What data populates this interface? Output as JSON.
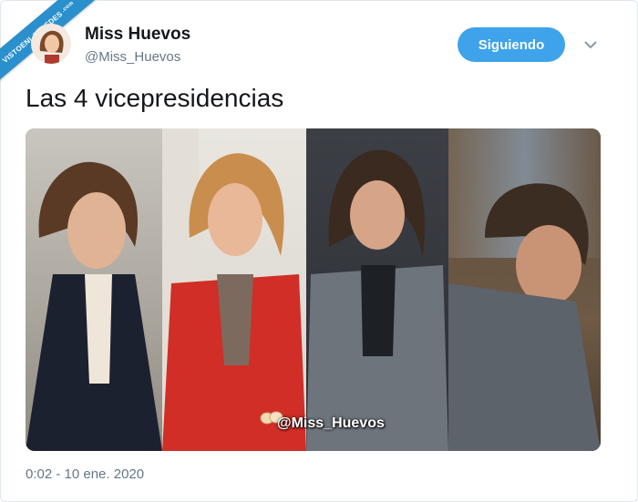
{
  "watermark_site": "VISTOENLASREDES",
  "watermark_site_suffix": ".com",
  "author": {
    "name": "Miss Huevos",
    "handle": "@Miss_Huevos"
  },
  "follow_button": {
    "label": "Siguiendo",
    "color": "#3ea3ea"
  },
  "tweet": {
    "text": "Las 4 vicepresidencias",
    "image_watermark": "@Miss_Huevos",
    "timestamp": "0:02 - 10 ene. 2020"
  },
  "icons": {
    "menu": "chevron-down-icon",
    "avatar": "avatar",
    "eggs": "eggs-icon"
  }
}
